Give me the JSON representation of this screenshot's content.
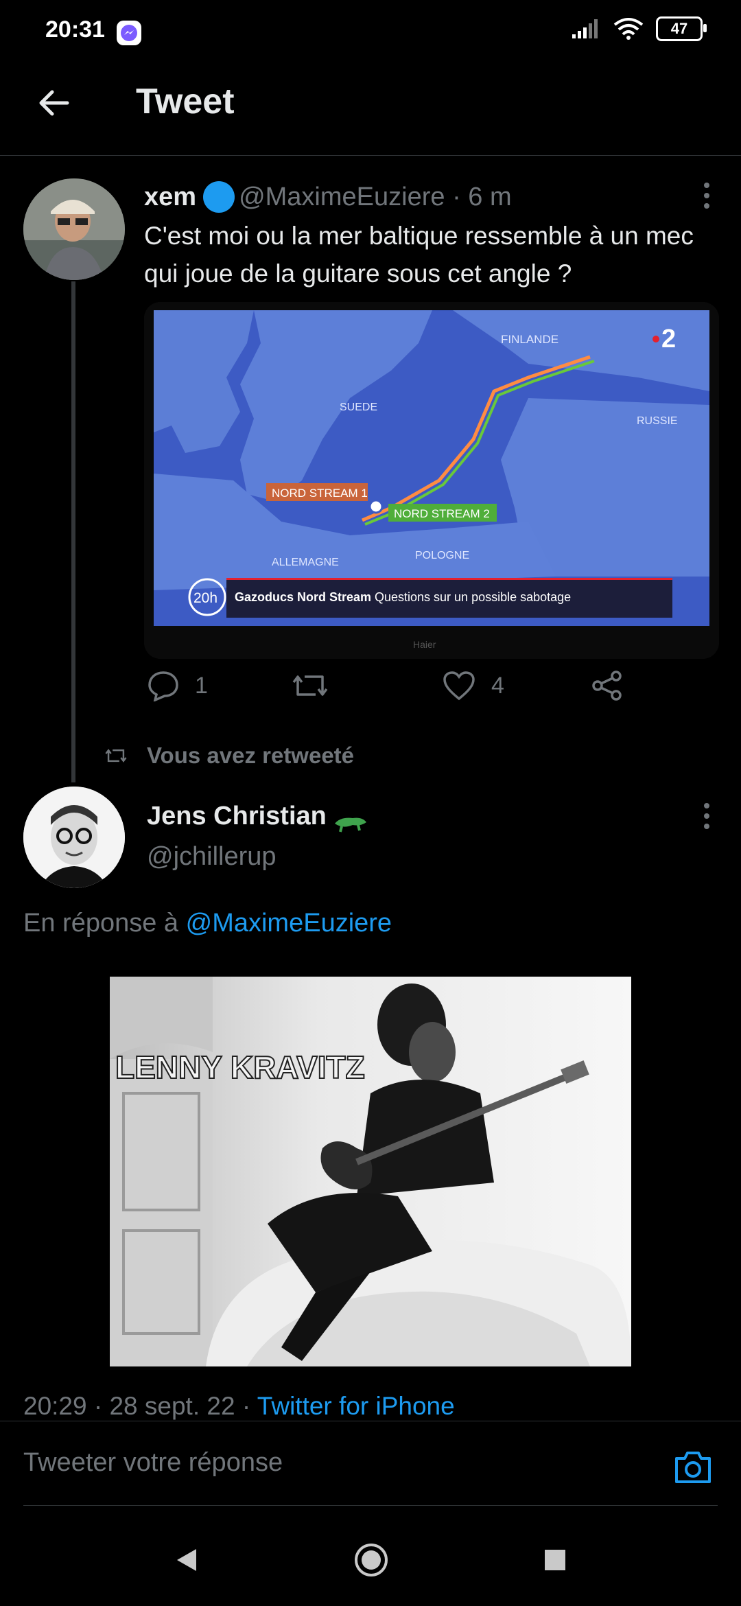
{
  "status_bar": {
    "time": "20:31",
    "battery": "47",
    "icons": [
      "messenger-icon",
      "signal-icon",
      "wifi-icon",
      "battery-icon"
    ]
  },
  "header": {
    "title": "Tweet",
    "back_icon": "arrow-left-icon"
  },
  "tweet": {
    "author_name": "xem",
    "author_handle": "@MaximeEuziere",
    "time_ago": "· 6 m",
    "text": "C'est moi ou la mer baltique ressemble à un mec qui joue de la guitare sous cet angle ?",
    "media": {
      "labels": {
        "finlande": "FINLANDE",
        "suede": "SUEDE",
        "russie": "RUSSIE",
        "ns1": "NORD STREAM 1",
        "ns2": "NORD STREAM 2",
        "allemagne": "ALLEMAGNE",
        "pologne": "POLOGNE",
        "channel_badge": "20h",
        "channel_logo": "2",
        "ticker_bold": "Gazoducs Nord Stream",
        "ticker_text": "Questions sur un possible sabotage",
        "tv_brand": "Haier"
      }
    },
    "actions": {
      "reply_count": "1",
      "retweet_count": "",
      "like_count": "4"
    }
  },
  "retweet_label": "Vous avez retweeté",
  "reply": {
    "author_name": "Jens Christian",
    "author_handle": "@jchillerup",
    "in_reply_prefix": "En réponse à",
    "in_reply_handle": "@MaximeEuziere",
    "media_caption": "LENNY KRAVITZ",
    "timestamp": "20:29 · 28 sept. 22 ·",
    "source": "Twitter for iPhone"
  },
  "composer": {
    "placeholder": "Tweeter votre réponse"
  },
  "colors": {
    "accent": "#1d9bf0",
    "background": "#000000",
    "muted": "#71767b"
  }
}
